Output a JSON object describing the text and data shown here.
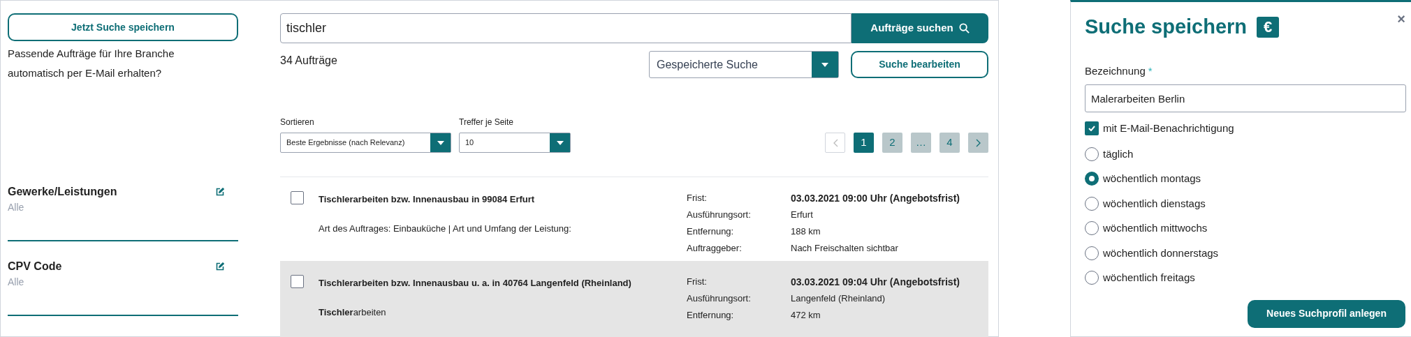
{
  "sidebar": {
    "save_button": "Jetzt Suche speichern",
    "prompt": "Passende Aufträge für Ihre Branche automatisch per E-Mail erhalten?",
    "filters": [
      {
        "title": "Gewerke/Leistungen",
        "value": "Alle"
      },
      {
        "title": "CPV Code",
        "value": "Alle"
      }
    ]
  },
  "search": {
    "value": "tischler",
    "button": "Aufträge suchen"
  },
  "result_count": "34 Aufträge",
  "saved_search": {
    "value": "Gespeicherte Suche"
  },
  "edit_button": "Suche bearbeiten",
  "sort": {
    "label": "Sortieren",
    "value": "Beste Ergebnisse (nach Relevanz)"
  },
  "per_page": {
    "label": "Treffer je Seite",
    "value": "10"
  },
  "pagination": {
    "prev_disabled": true,
    "next_disabled": false,
    "pages": [
      {
        "label": "1",
        "selected": true
      },
      {
        "label": "2",
        "selected": false
      },
      {
        "label": "…",
        "selected": false
      },
      {
        "label": "4",
        "selected": false
      }
    ]
  },
  "results": [
    {
      "title": "Tischlerarbeiten bzw. Innenausbau in 99084 Erfurt",
      "description": "Art des Auftrages: Einbauküche | Art und Umfang der Leistung:",
      "checked": false,
      "highlighted": false,
      "details": [
        {
          "label": "Frist:",
          "value": "03.03.2021 09:00 Uhr (Angebotsfrist)",
          "kind": "deadline"
        },
        {
          "label": "Ausführungsort:",
          "value": "Erfurt",
          "kind": "plain"
        },
        {
          "label": "Entfernung:",
          "value": "188 km",
          "kind": "plain"
        },
        {
          "label": "Auftraggeber:",
          "value": "Nach Freischalten sichtbar",
          "kind": "plain"
        }
      ]
    },
    {
      "title": "Tischlerarbeiten bzw. Innenausbau u. a. in 40764 Langenfeld (Rheinland)",
      "description": "**Tischler**arbeiten",
      "checked": false,
      "highlighted": true,
      "details": [
        {
          "label": "Frist:",
          "value": "03.03.2021 09:04 Uhr (Angebotsfrist)",
          "kind": "deadline"
        },
        {
          "label": "Ausführungsort:",
          "value": "Langenfeld (Rheinland)",
          "kind": "plain"
        },
        {
          "label": "Entfernung:",
          "value": "472 km",
          "kind": "plain"
        }
      ]
    }
  ],
  "dialog": {
    "title": "Suche speichern",
    "badge": "€",
    "close": "×",
    "field_label": "Bezeichnung",
    "required_mark": "*",
    "field_value": "Malerarbeiten Berlin",
    "notify": {
      "label": "mit E-Mail-Benachrichtigung",
      "checked": true
    },
    "frequencies": [
      {
        "label": "täglich",
        "selected": false
      },
      {
        "label": "wöchentlich montags",
        "selected": true
      },
      {
        "label": "wöchentlich dienstags",
        "selected": false
      },
      {
        "label": "wöchentlich mittwochs",
        "selected": false
      },
      {
        "label": "wöchentlich donnerstags",
        "selected": false
      },
      {
        "label": "wöchentlich freitags",
        "selected": false
      }
    ],
    "submit": "Neues Suchprofil anlegen"
  }
}
